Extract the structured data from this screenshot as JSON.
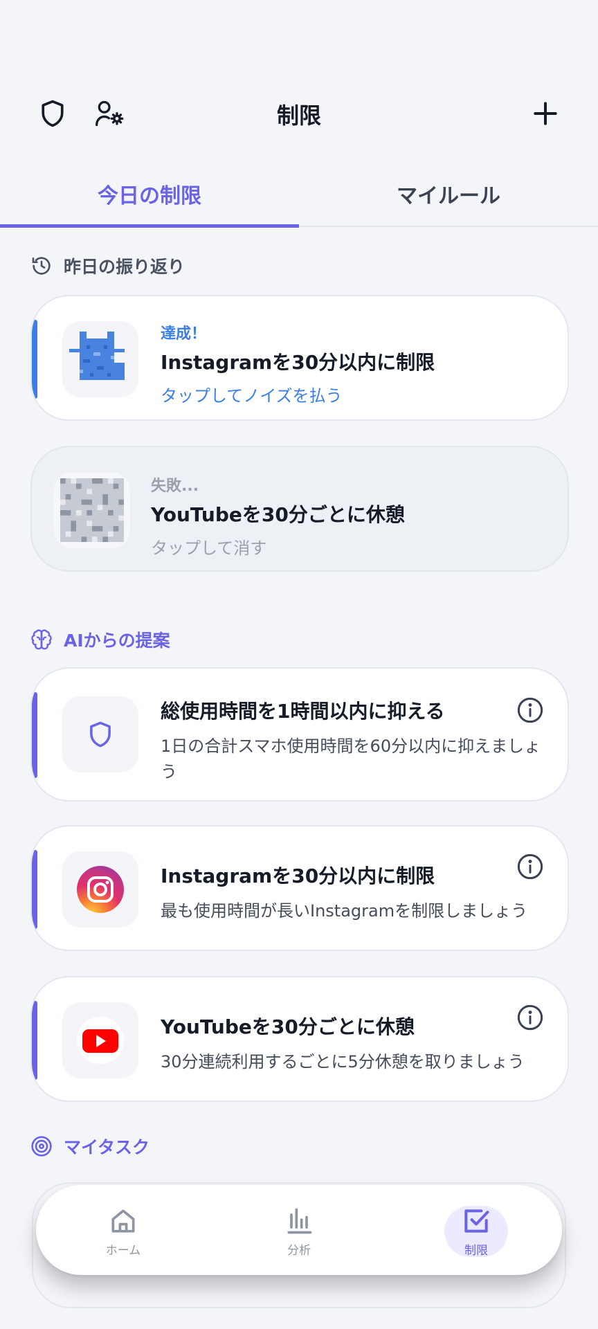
{
  "header": {
    "title": "制限",
    "icons": [
      "shield-icon",
      "user-settings-icon",
      "plus-icon"
    ]
  },
  "tabs": [
    {
      "label": "今日の制限",
      "active": true
    },
    {
      "label": "マイルール",
      "active": false
    }
  ],
  "review": {
    "title": "昨日の振り返り",
    "items": [
      {
        "status": "達成！",
        "title": "Instagramを30分以内に制限",
        "subtitle": "タップしてノイズを払う"
      },
      {
        "status": "失敗...",
        "title": "YouTubeを30分ごとに休憩",
        "subtitle": "タップして消す"
      }
    ]
  },
  "suggestions": {
    "title": "AIからの提案",
    "items": [
      {
        "title": "総使用時間を1時間以内に抑える",
        "description": "1日の合計スマホ使用時間を60分以内に抑えましょう",
        "icon": "shield-icon"
      },
      {
        "title": "Instagramを30分以内に制限",
        "description": "最も使用時間が長いInstagramを制限しましょう",
        "icon": "instagram-icon"
      },
      {
        "title": "YouTubeを30分ごとに休憩",
        "description": "30分連続利用するごとに5分休憩を取りましょう",
        "icon": "youtube-icon"
      }
    ]
  },
  "tasks": {
    "title": "マイタスク"
  },
  "nav": [
    {
      "label": "ホーム",
      "icon": "home-icon"
    },
    {
      "label": "分析",
      "icon": "bar-chart-icon"
    },
    {
      "label": "制限",
      "icon": "checkbox-icon",
      "active": true
    }
  ],
  "colors": {
    "accent": "#6a63e6",
    "success": "#3d7ee6",
    "background": "#f3f5f9"
  }
}
